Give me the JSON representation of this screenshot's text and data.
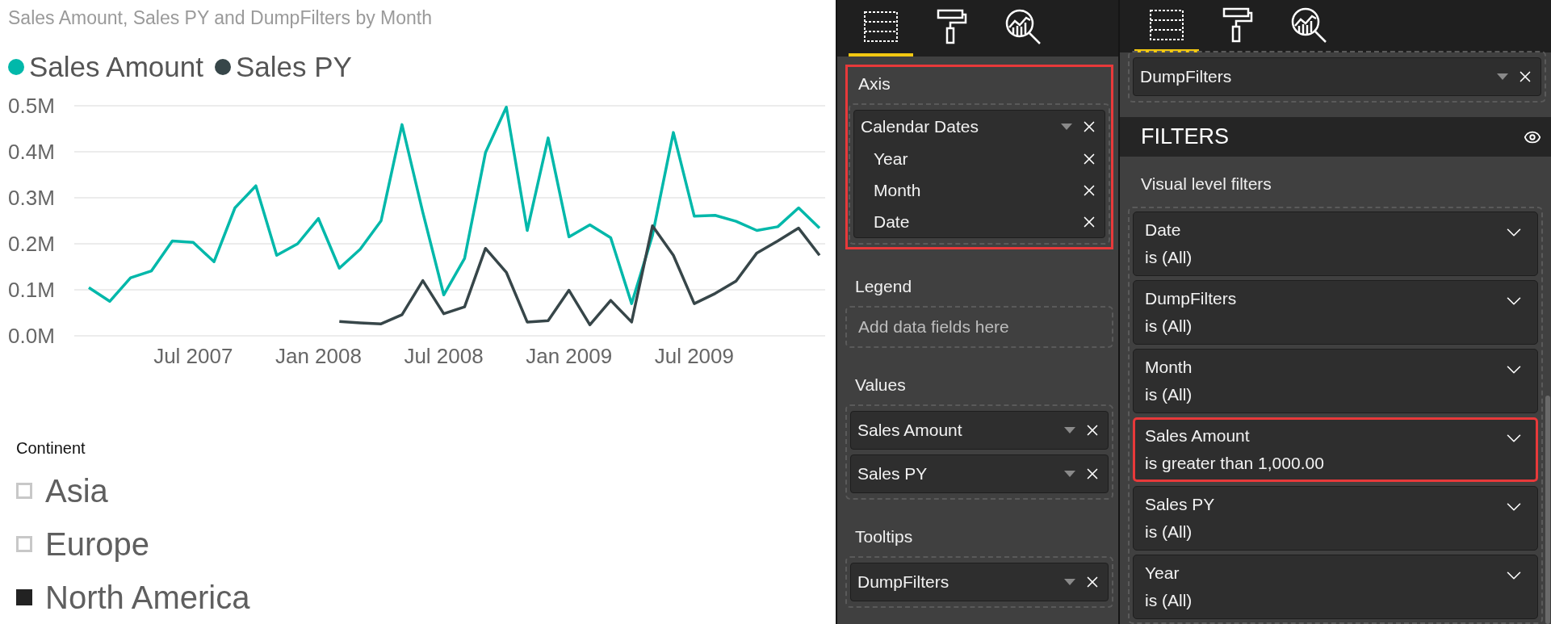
{
  "chart": {
    "title": "Sales Amount, Sales PY and DumpFilters by Month",
    "chart_data": {
      "type": "line",
      "categories": [
        null,
        null,
        null,
        null,
        null,
        "Jul 2007",
        null,
        null,
        null,
        null,
        null,
        "Jan 2008",
        null,
        null,
        null,
        null,
        null,
        "Jul 2008",
        null,
        null,
        null,
        null,
        null,
        "Jan 2009",
        null,
        null,
        null,
        null,
        null,
        "Jul 2009",
        null,
        null,
        null,
        null,
        null,
        null
      ],
      "grid": true,
      "series": [
        {
          "name": "Sales Amount",
          "color": "#01b8aa",
          "values": [
            0.105,
            0.075,
            0.126,
            0.141,
            0.206,
            0.203,
            0.161,
            0.278,
            0.326,
            0.175,
            0.2,
            0.255,
            0.147,
            0.188,
            0.25,
            0.459,
            0.268,
            0.089,
            0.168,
            0.398,
            0.497,
            0.229,
            0.43,
            0.215,
            0.241,
            0.213,
            0.07,
            0.218,
            0.442,
            0.26,
            0.262,
            0.249,
            0.229,
            0.237,
            0.278,
            0.234
          ]
        },
        {
          "name": "Sales PY",
          "color": "#374649",
          "values": [
            null,
            null,
            null,
            null,
            null,
            null,
            null,
            null,
            null,
            null,
            null,
            null,
            0.031,
            0.028,
            0.026,
            0.046,
            0.12,
            0.048,
            0.063,
            0.19,
            0.138,
            0.03,
            0.033,
            0.099,
            0.024,
            0.077,
            0.03,
            0.239,
            0.175,
            0.07,
            0.092,
            0.119,
            0.18,
            0.206,
            0.234,
            0.175
          ]
        }
      ],
      "ylim": [
        0,
        0.5
      ],
      "yticks": [
        {
          "value": 0,
          "label": "0.0M"
        },
        {
          "value": 0.1,
          "label": "0.1M"
        },
        {
          "value": 0.2,
          "label": "0.2M"
        },
        {
          "value": 0.3,
          "label": "0.3M"
        },
        {
          "value": 0.4,
          "label": "0.4M"
        },
        {
          "value": 0.5,
          "label": "0.5M"
        }
      ]
    }
  },
  "slicer": {
    "title": "Continent",
    "items": [
      {
        "label": "Asia",
        "selected": false
      },
      {
        "label": "Europe",
        "selected": false
      },
      {
        "label": "North America",
        "selected": true
      }
    ]
  },
  "fields_pane": {
    "tabs": [
      {
        "kind": "fields",
        "selected": true
      },
      {
        "kind": "format",
        "selected": false
      },
      {
        "kind": "analytics",
        "selected": false
      }
    ],
    "wells": [
      {
        "label": "Axis",
        "highlighted": true,
        "fields": [
          {
            "name": "Calendar Dates",
            "children": [
              {
                "name": "Year"
              },
              {
                "name": "Month"
              },
              {
                "name": "Date"
              }
            ]
          }
        ]
      },
      {
        "label": "Legend",
        "highlighted": false,
        "placeholder": "Add data fields here"
      },
      {
        "label": "Values",
        "highlighted": false,
        "fields": [
          {
            "name": "Sales Amount"
          },
          {
            "name": "Sales PY"
          }
        ]
      },
      {
        "label": "Tooltips",
        "highlighted": false,
        "fields": [
          {
            "name": "DumpFilters"
          }
        ]
      }
    ]
  },
  "filters_pane": {
    "tabs": [
      {
        "kind": "fields",
        "selected": true
      },
      {
        "kind": "format",
        "selected": false
      },
      {
        "kind": "analytics",
        "selected": false
      }
    ],
    "well_fields": [
      {
        "name": "DumpFilters"
      }
    ],
    "title": "FILTERS",
    "section": "Visual level filters",
    "filters": [
      {
        "field": "Date",
        "condition": "is (All)",
        "highlighted": false
      },
      {
        "field": "DumpFilters",
        "condition": "is (All)",
        "highlighted": false
      },
      {
        "field": "Month",
        "condition": "is (All)",
        "highlighted": false
      },
      {
        "field": "Sales Amount",
        "condition": "is greater than 1,000.00",
        "highlighted": true
      },
      {
        "field": "Sales PY",
        "condition": "is (All)",
        "highlighted": false
      },
      {
        "field": "Year",
        "condition": "is (All)",
        "highlighted": false
      }
    ]
  }
}
